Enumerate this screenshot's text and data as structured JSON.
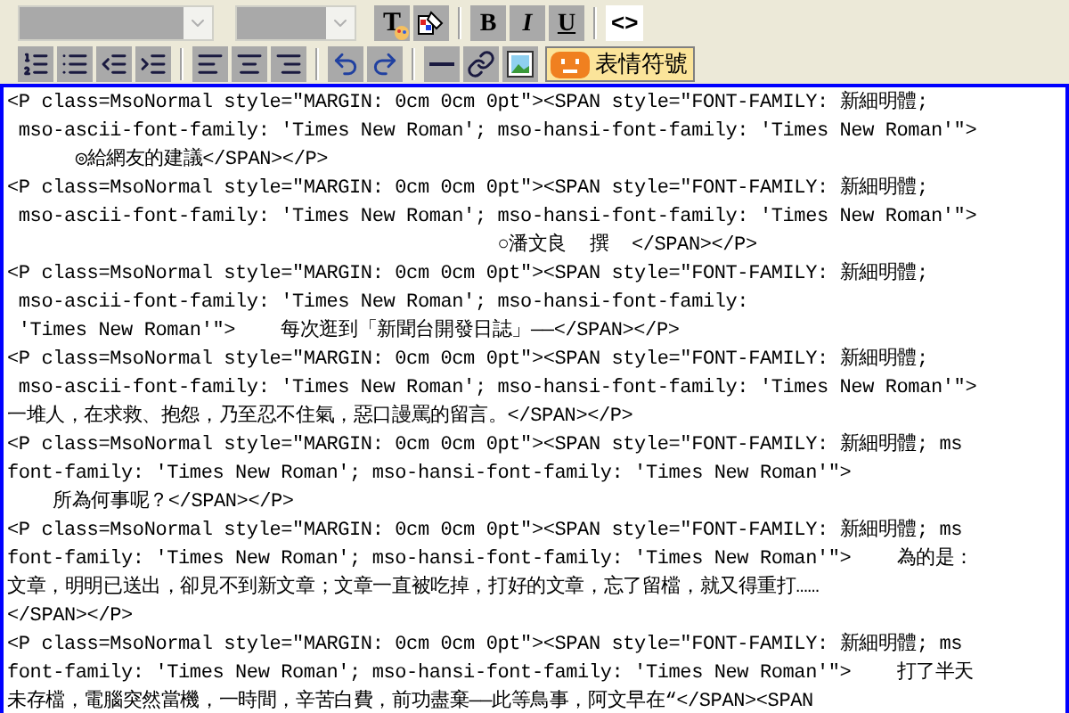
{
  "toolbar": {
    "font_select": {
      "disabled": true
    },
    "size_select": {
      "disabled": true
    },
    "row_1": [
      {
        "kind": "text_color",
        "label": "T"
      },
      {
        "kind": "fill_color"
      },
      {
        "kind": "sep"
      },
      {
        "kind": "bold",
        "label": "B"
      },
      {
        "kind": "italic",
        "label": "I"
      },
      {
        "kind": "underline",
        "label": "U"
      },
      {
        "kind": "sep"
      },
      {
        "kind": "source",
        "label": "<>",
        "selected": true
      }
    ],
    "row_2": [
      {
        "kind": "ordered_list"
      },
      {
        "kind": "bullet_list"
      },
      {
        "kind": "outdent"
      },
      {
        "kind": "indent"
      },
      {
        "kind": "sep"
      },
      {
        "kind": "align_left"
      },
      {
        "kind": "align_center"
      },
      {
        "kind": "align_right"
      },
      {
        "kind": "sep"
      },
      {
        "kind": "undo"
      },
      {
        "kind": "redo"
      },
      {
        "kind": "sep"
      },
      {
        "kind": "rule"
      },
      {
        "kind": "link"
      },
      {
        "kind": "image"
      },
      {
        "kind": "emoticon",
        "label": "表情符號"
      }
    ]
  },
  "source_lines": [
    "<P class=MsoNormal style=\"MARGIN: 0cm 0cm 0pt\"><SPAN style=\"FONT-FAMILY: 新細明體;",
    " mso-ascii-font-family: 'Times New Roman'; mso-hansi-font-family: 'Times New Roman'\">",
    "      ◎給網友的建議</SPAN></P>",
    "<P class=MsoNormal style=\"MARGIN: 0cm 0cm 0pt\"><SPAN style=\"FONT-FAMILY: 新細明體;",
    " mso-ascii-font-family: 'Times New Roman'; mso-hansi-font-family: 'Times New Roman'\">",
    "                                           ○潘文良  撰  </SPAN></P>",
    "<P class=MsoNormal style=\"MARGIN: 0cm 0cm 0pt\"><SPAN style=\"FONT-FAMILY: 新細明體;",
    " mso-ascii-font-family: 'Times New Roman'; mso-hansi-font-family:",
    " 'Times New Roman'\">    每次逛到「新聞台開發日誌」——</SPAN></P>",
    "<P class=MsoNormal style=\"MARGIN: 0cm 0cm 0pt\"><SPAN style=\"FONT-FAMILY: 新細明體;",
    " mso-ascii-font-family: 'Times New Roman'; mso-hansi-font-family: 'Times New Roman'\">",
    "一堆人，在求救、抱怨，乃至忍不住氣，惡口謾罵的留言。</SPAN></P>",
    "<P class=MsoNormal style=\"MARGIN: 0cm 0cm 0pt\"><SPAN style=\"FONT-FAMILY: 新細明體; ms",
    "font-family: 'Times New Roman'; mso-hansi-font-family: 'Times New Roman'\">",
    "    所為何事呢？</SPAN></P>",
    "<P class=MsoNormal style=\"MARGIN: 0cm 0cm 0pt\"><SPAN style=\"FONT-FAMILY: 新細明體; ms",
    "font-family: 'Times New Roman'; mso-hansi-font-family: 'Times New Roman'\">    為的是：",
    "文章，明明已送出，卻見不到新文章；文章一直被吃掉，打好的文章，忘了留檔，就又得重打……",
    "</SPAN></P>",
    "<P class=MsoNormal style=\"MARGIN: 0cm 0cm 0pt\"><SPAN style=\"FONT-FAMILY: 新細明體; ms",
    "font-family: 'Times New Roman'; mso-hansi-font-family: 'Times New Roman'\">    打了半天",
    "未存檔，電腦突然當機，一時間，辛苦白費，前功盡棄——此等鳥事，阿文早在“</SPAN><SPAN"
  ]
}
